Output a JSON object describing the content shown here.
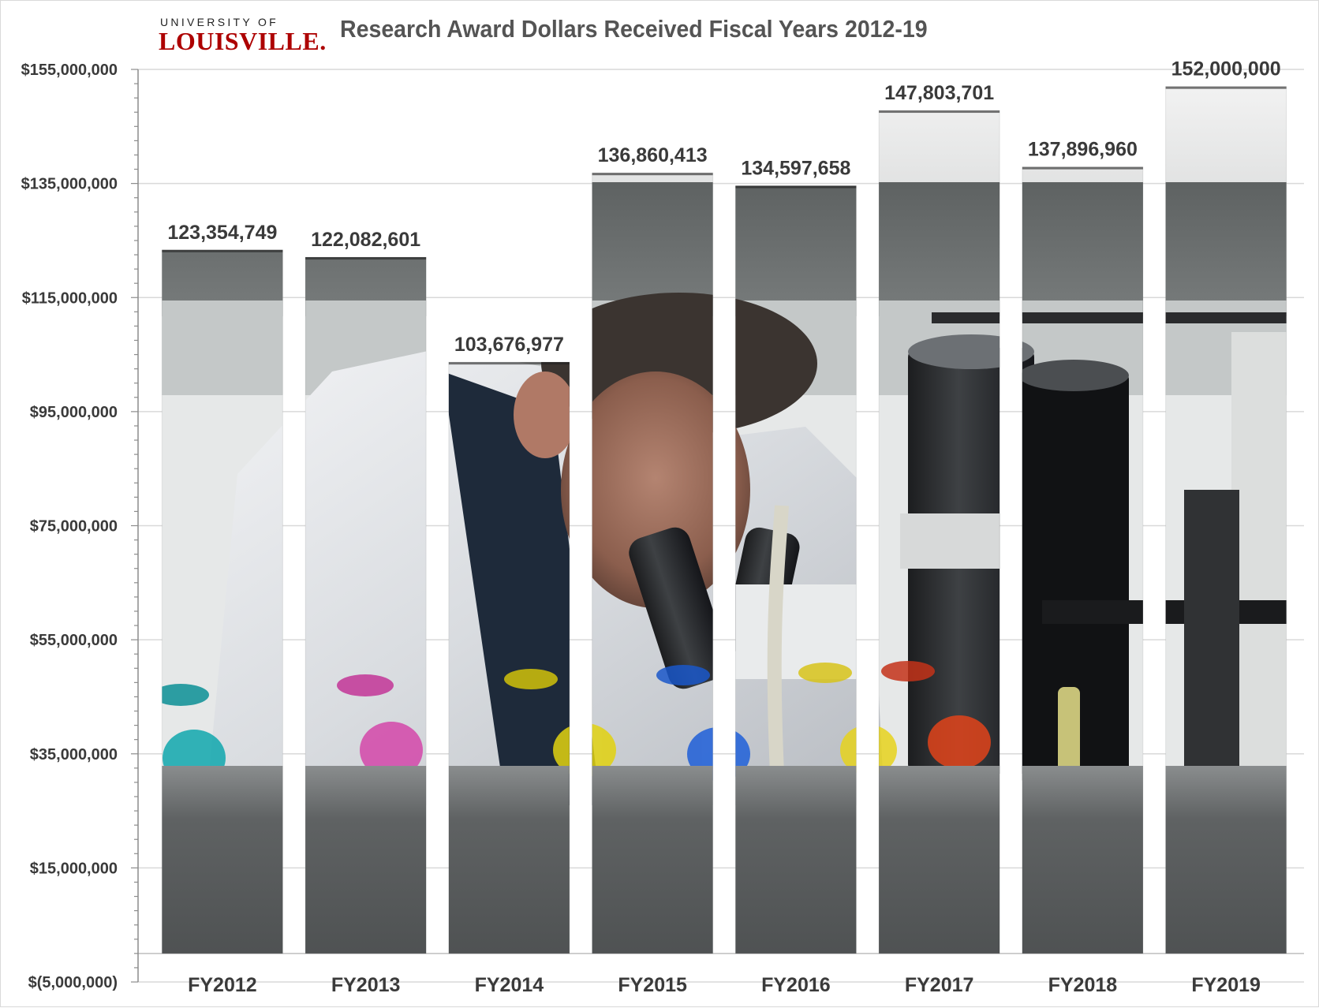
{
  "logo": {
    "line1": "UNIVERSITY OF",
    "line2": "LOUISVILLE."
  },
  "colors": {
    "brand_red": "#ad0000",
    "title_gray": "#545454",
    "text_dark": "#3a3a3a",
    "gridline": "#d9d9d9"
  },
  "chart_data": {
    "type": "bar",
    "title": "Research Award Dollars Received Fiscal Years 2012-19",
    "xlabel": "",
    "ylabel": "",
    "categories": [
      "FY2012",
      "FY2013",
      "FY2014",
      "FY2015",
      "FY2016",
      "FY2017",
      "FY2018",
      "FY2019"
    ],
    "values": [
      123354749,
      122082601,
      103676977,
      136860413,
      134597658,
      147803701,
      137896960,
      152000000
    ],
    "data_labels": [
      "123,354,749",
      "122,082,601",
      "103,676,977",
      "136,860,413",
      "134,597,658",
      "147,803,701",
      "137,896,960",
      "152,000,000"
    ],
    "ylim": [
      -5000000,
      155000000
    ],
    "y_ticks": [
      -5000000,
      15000000,
      35000000,
      55000000,
      75000000,
      95000000,
      115000000,
      135000000,
      155000000
    ],
    "y_tick_labels": [
      "$(5,000,000)",
      "$15,000,000",
      "$35,000,000",
      "$55,000,000",
      "$75,000,000",
      "$95,000,000",
      "$115,000,000",
      "$135,000,000",
      "$155,000,000"
    ],
    "grid": true,
    "legend": "none",
    "bar_fill": "photograph of a researcher at a microscope in a laboratory"
  }
}
